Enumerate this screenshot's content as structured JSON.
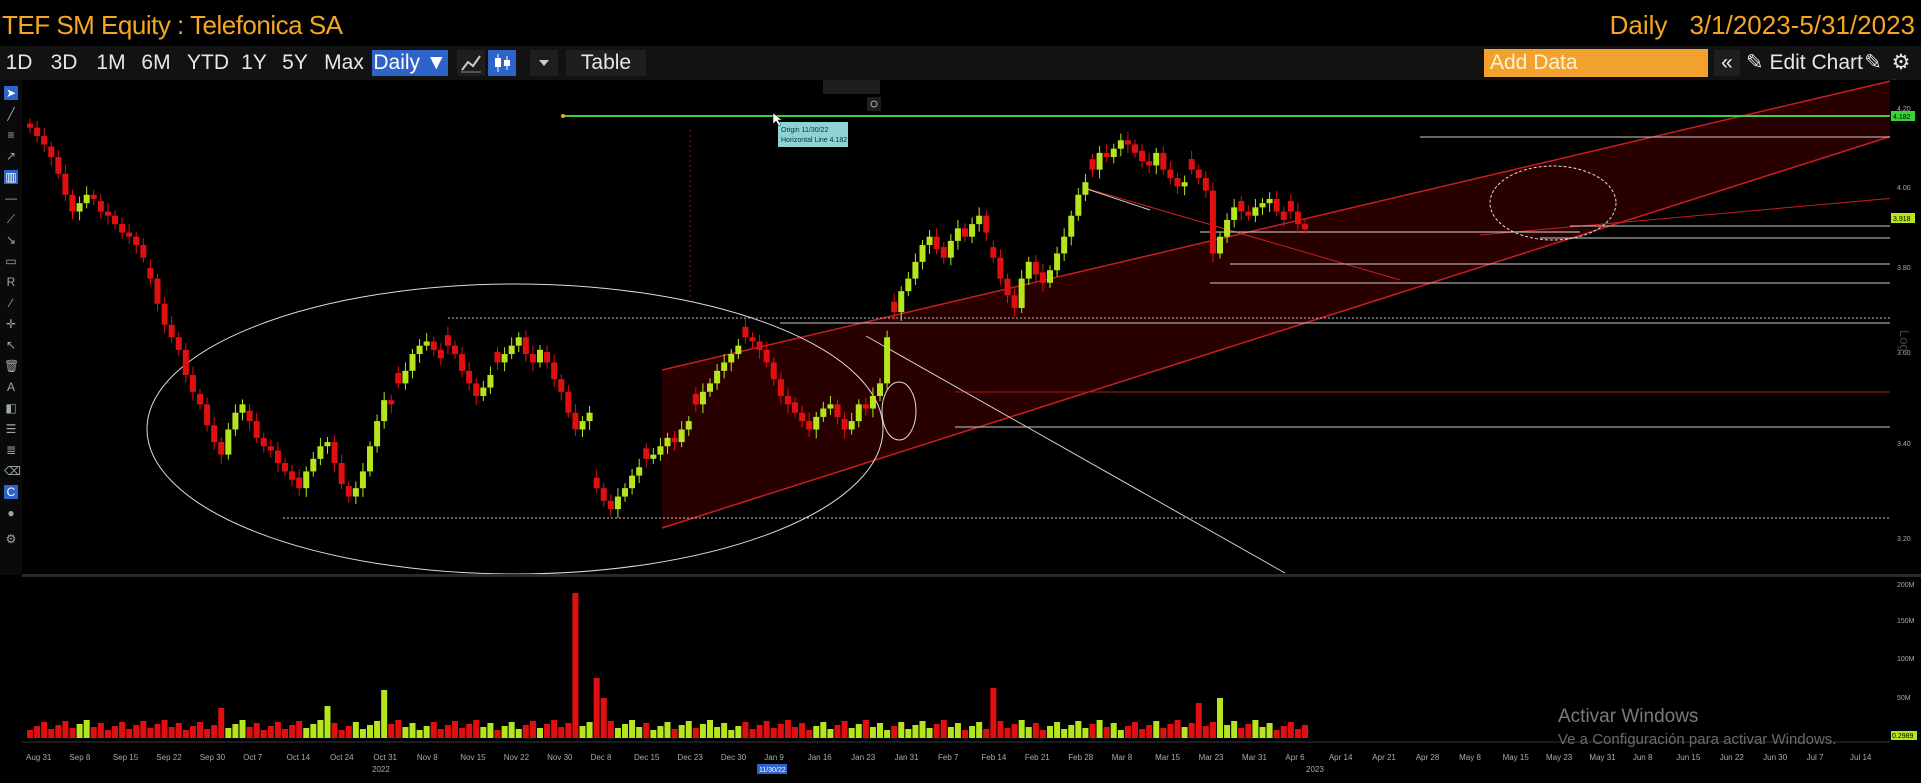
{
  "header": {
    "security_title": "TEF SM Equity : Telefonica SA",
    "period": "Daily",
    "date_range": "3/1/2023-5/31/2023"
  },
  "toolbar": {
    "ranges": [
      "1D",
      "3D",
      "1M",
      "6M",
      "YTD",
      "1Y",
      "5Y",
      "Max"
    ],
    "frequency_label": "Daily ▼",
    "table_label": "Table",
    "add_data_placeholder": "Add Data",
    "edit_chart_label": "Edit Chart",
    "collapse_label": "«"
  },
  "annotation": {
    "origin": "Origin 11/30/22",
    "line": "Horizontal Line 4.182"
  },
  "price_axis": {
    "scale_label": "Log",
    "ticks": [
      "4.20",
      "4.00",
      "3.80",
      "3.60",
      "3.40",
      "3.20"
    ],
    "current_tag": "3.918",
    "line_tag": "4.182"
  },
  "volume_axis": {
    "ticks": [
      "200M",
      "150M",
      "100M",
      "50M"
    ],
    "current_tag": "0.2989"
  },
  "x_axis": {
    "labels": [
      "Aug 31",
      "Sep 8",
      "Sep 15",
      "Sep 22",
      "Sep 30",
      "Oct 7",
      "Oct 14",
      "Oct 24",
      "Oct 31",
      "Nov 8",
      "Nov 15",
      "Nov 22",
      "Nov 30",
      "Dec 8",
      "Dec 15",
      "Dec 23",
      "Dec 30",
      "Jan 9",
      "Jan 16",
      "Jan 23",
      "Jan 31",
      "Feb 7",
      "Feb 14",
      "Feb 21",
      "Feb 28",
      "Mar 8",
      "Mar 15",
      "Mar 23",
      "Mar 31",
      "Apr 6",
      "Apr 14",
      "Apr 21",
      "Apr 28",
      "May 8",
      "May 15",
      "May 23",
      "May 31",
      "Jun 8",
      "Jun 15",
      "Jun 22",
      "Jun 30",
      "Jul 7",
      "Jul 14"
    ],
    "year_2022": "2022",
    "year_2023": "2023",
    "cursor_date": "11/30/22"
  },
  "watermark": {
    "line1": "Activar Windows",
    "line2": "Ve a Configuración para activar Windows."
  },
  "colors": {
    "up": "#b5e61d",
    "down": "#e01010",
    "accent": "#f5a623",
    "active": "#2e63c9",
    "channel": "#c81e1e",
    "level_line": "#3ad13a"
  },
  "chart_data": {
    "type": "candlestick",
    "title": "TEF SM Equity : Telefonica SA",
    "frequency": "Daily",
    "ylim": [
      3.1,
      4.25
    ],
    "ylabel_scale": "Log",
    "horizontal_line": 4.182,
    "closes": [
      4.16,
      4.14,
      4.12,
      4.09,
      4.05,
      4.0,
      3.96,
      3.98,
      4.0,
      3.99,
      3.96,
      3.95,
      3.93,
      3.91,
      3.9,
      3.88,
      3.85,
      3.8,
      3.74,
      3.69,
      3.66,
      3.63,
      3.57,
      3.53,
      3.5,
      3.45,
      3.41,
      3.38,
      3.44,
      3.48,
      3.5,
      3.46,
      3.42,
      3.4,
      3.39,
      3.36,
      3.34,
      3.32,
      3.3,
      3.34,
      3.37,
      3.4,
      3.41,
      3.36,
      3.31,
      3.28,
      3.3,
      3.34,
      3.4,
      3.46,
      3.51,
      3.5,
      3.55,
      3.58,
      3.62,
      3.64,
      3.65,
      3.63,
      3.61,
      3.64,
      3.62,
      3.58,
      3.55,
      3.52,
      3.54,
      3.57,
      3.6,
      3.62,
      3.64,
      3.66,
      3.62,
      3.6,
      3.63,
      3.6,
      3.56,
      3.53,
      3.48,
      3.44,
      3.46,
      3.48,
      3.3,
      3.27,
      3.25,
      3.28,
      3.3,
      3.33,
      3.35,
      3.37,
      3.38,
      3.4,
      3.42,
      3.41,
      3.44,
      3.46,
      3.5,
      3.53,
      3.55,
      3.58,
      3.6,
      3.62,
      3.64,
      3.66,
      3.65,
      3.63,
      3.6,
      3.56,
      3.52,
      3.5,
      3.48,
      3.46,
      3.44,
      3.47,
      3.49,
      3.5,
      3.47,
      3.44,
      3.46,
      3.5,
      3.49,
      3.52,
      3.55,
      3.66,
      3.72,
      3.77,
      3.8,
      3.84,
      3.88,
      3.9,
      3.87,
      3.85,
      3.89,
      3.92,
      3.9,
      3.93,
      3.95,
      3.91,
      3.85,
      3.8,
      3.76,
      3.73,
      3.8,
      3.84,
      3.81,
      3.79,
      3.82,
      3.86,
      3.9,
      3.95,
      4.0,
      4.03,
      4.06,
      4.1,
      4.09,
      4.11,
      4.13,
      4.12,
      4.1,
      4.08,
      4.07,
      4.1,
      4.06,
      4.04,
      4.02,
      4.03,
      4.06,
      4.04,
      4.01,
      3.86,
      3.9,
      3.94,
      3.97,
      3.96,
      3.95,
      3.97,
      3.98,
      3.99,
      3.96,
      3.94,
      3.96,
      3.93,
      3.918
    ]
  }
}
